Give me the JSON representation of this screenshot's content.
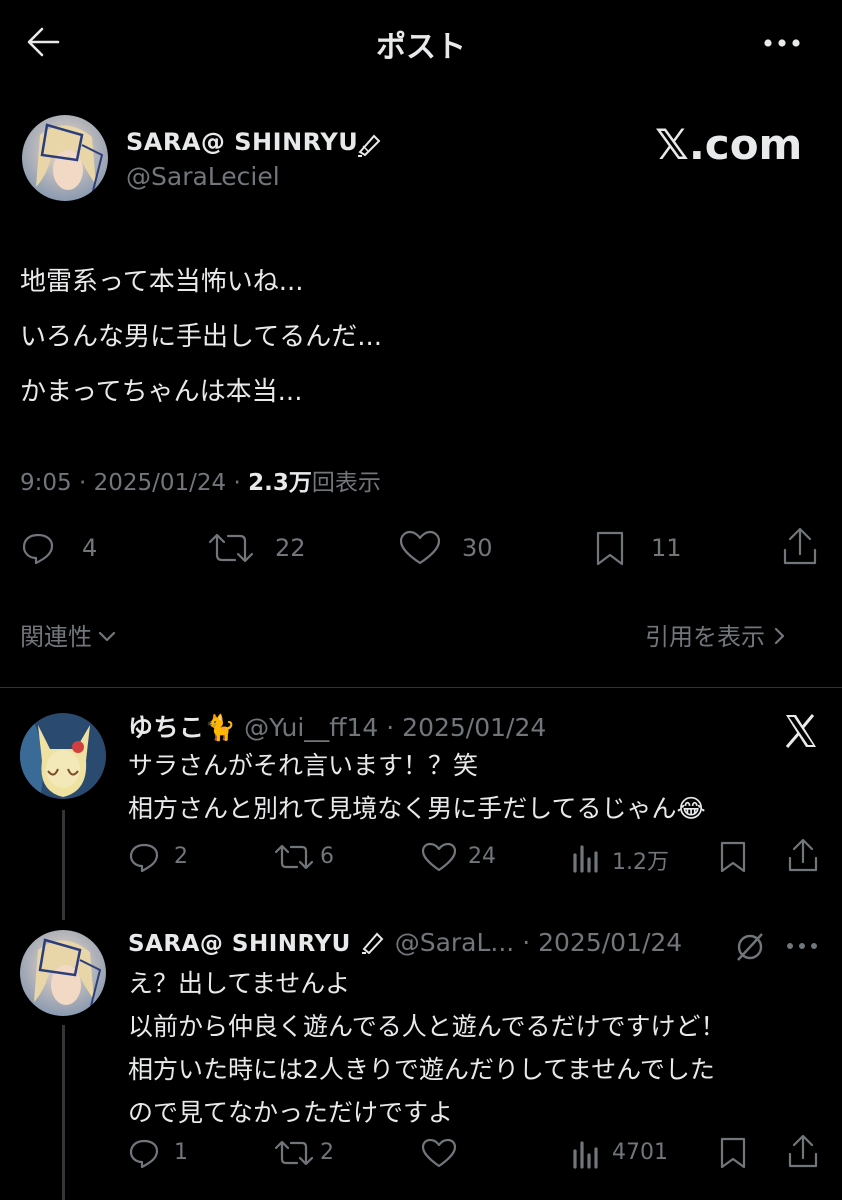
{
  "header": {
    "title": "ポスト",
    "back_icon": "arrow-left-icon",
    "more_icon": "more-horizontal-icon"
  },
  "watermark": "𝕏.com",
  "post": {
    "display_name": "SARA@ SHINRYU",
    "handle": "@SaraLeciel",
    "text_lines": [
      "地雷系って本当怖いね...",
      "いろんな男に手出してるんだ...",
      "かまってちゃんは本当..."
    ],
    "time": "9:05 · 2025/01/24 · ",
    "views_value": "2.3万",
    "views_label": "回表示",
    "replies": "4",
    "reposts": "22",
    "likes": "30",
    "bookmarks": "11",
    "relevance_label": "関連性",
    "quotes_label": "引用を表示"
  },
  "replies": [
    {
      "display_name": "ゆちこ🐈",
      "meta": "@Yui__ff14 · 2025/01/24",
      "text_lines": [
        "サラさんがそれ言います！？笑",
        "相方さんと別れて見境なく男に手だしてるじゃん😂"
      ],
      "replies": "2",
      "reposts": "6",
      "likes": "24",
      "views": "1.2万"
    },
    {
      "display_name": "SARA@ SHINRYU",
      "meta": "@SaraL... · 2025/01/24",
      "text_lines": [
        "え？出してませんよ",
        "以前から仲良く遊んでる人と遊んでるだけですけど！",
        "相方いた時には2人きりで遊んだりしてませんでした",
        "ので見てなかっただけですよ"
      ],
      "replies": "1",
      "reposts": "2",
      "likes": "",
      "views": "4701"
    }
  ],
  "colors": {
    "background": "#000000",
    "text": "#e7e9ea",
    "muted": "#71767b",
    "divider": "#2f3336"
  }
}
